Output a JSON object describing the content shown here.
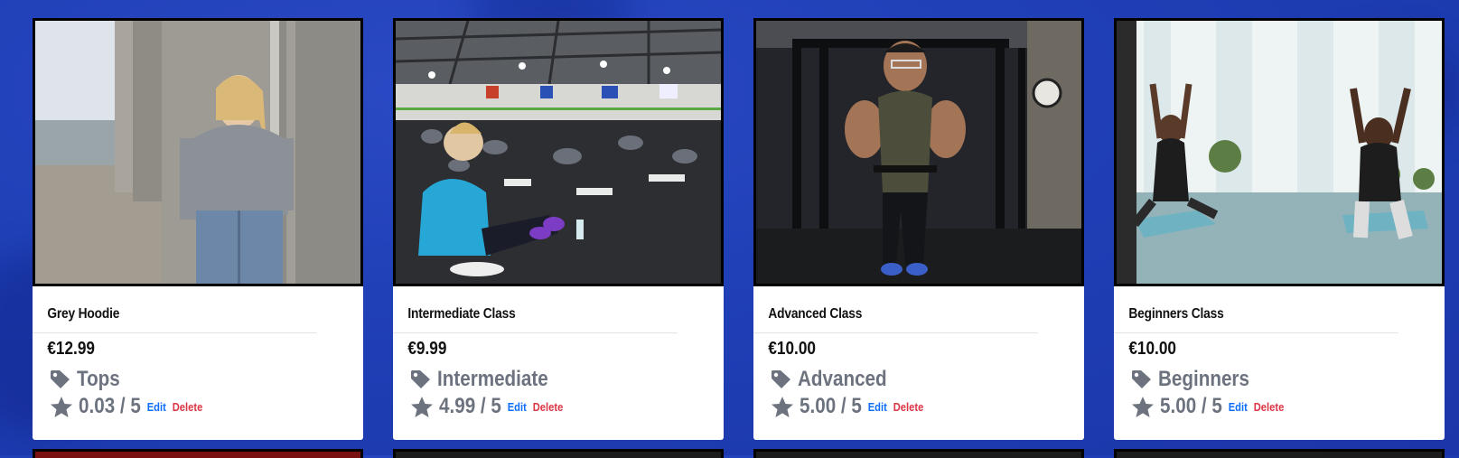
{
  "products": [
    {
      "name": "Grey Hoodie",
      "price": "€12.99",
      "category": "Tops",
      "rating": "0.03 / 5",
      "edit": "Edit",
      "delete": "Delete",
      "image": "woman in grey hoodie by stone pillars"
    },
    {
      "name": "Intermediate Class",
      "price": "€9.99",
      "category": "Intermediate",
      "rating": "4.99 / 5",
      "edit": "Edit",
      "delete": "Delete",
      "image": "group fitness class in gym"
    },
    {
      "name": "Advanced Class",
      "price": "€10.00",
      "category": "Advanced",
      "rating": "5.00 / 5",
      "edit": "Edit",
      "delete": "Delete",
      "image": "man on cable machine"
    },
    {
      "name": "Beginners Class",
      "price": "€10.00",
      "category": "Beginners",
      "rating": "5.00 / 5",
      "edit": "Edit",
      "delete": "Delete",
      "image": "two people doing yoga"
    }
  ],
  "colors": {
    "accent": "#0d6efd",
    "danger": "#dc3545",
    "muted": "#6c737f",
    "background": "#2040b8"
  },
  "icons": {
    "category": "tag-icon",
    "rating": "star-icon"
  }
}
